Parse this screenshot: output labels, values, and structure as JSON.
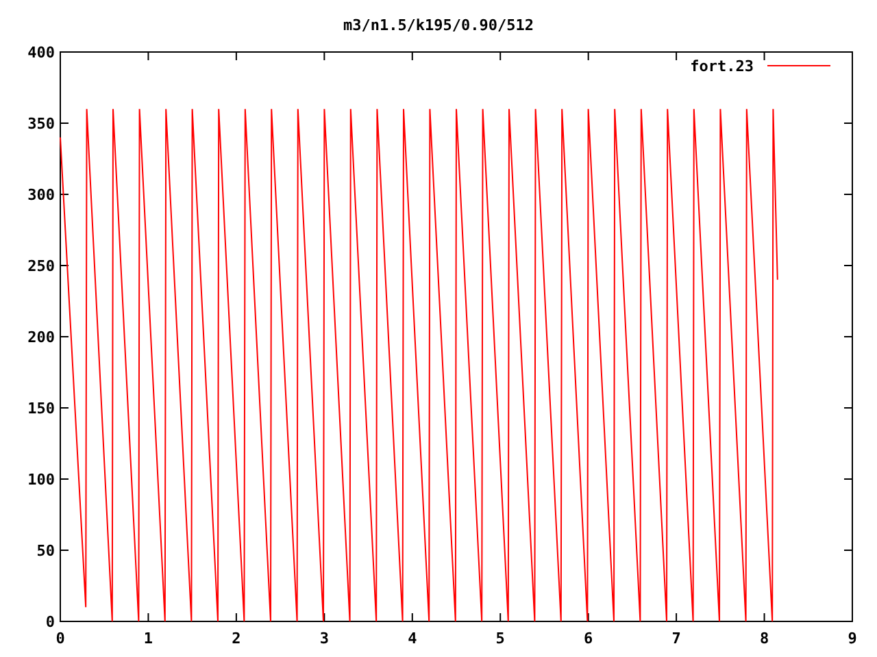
{
  "chart_data": {
    "type": "line",
    "title": "m3/n1.5/k195/0.90/512",
    "xlim": [
      0,
      9
    ],
    "ylim": [
      0,
      400
    ],
    "xticks": [
      0,
      1,
      2,
      3,
      4,
      5,
      6,
      7,
      8,
      9
    ],
    "yticks": [
      0,
      50,
      100,
      150,
      200,
      250,
      300,
      350,
      400
    ],
    "x": [
      0,
      0.29,
      0.3,
      0.59,
      0.6,
      0.89,
      0.9,
      1.19,
      1.2,
      1.49,
      1.5,
      1.79,
      1.8,
      2.09,
      2.1,
      2.39,
      2.4,
      2.69,
      2.7,
      2.99,
      3.0,
      3.29,
      3.3,
      3.59,
      3.6,
      3.89,
      3.9,
      4.19,
      4.2,
      4.49,
      4.5,
      4.79,
      4.8,
      5.09,
      5.1,
      5.39,
      5.4,
      5.69,
      5.7,
      5.99,
      6.0,
      6.29,
      6.3,
      6.59,
      6.6,
      6.89,
      6.9,
      7.19,
      7.2,
      7.49,
      7.5,
      7.79,
      7.8,
      8.09,
      8.1,
      8.15
    ],
    "series": [
      {
        "name": "fort.23",
        "color": "#ff0000",
        "values": [
          340,
          10,
          360,
          0,
          360,
          0,
          360,
          0,
          360,
          0,
          360,
          0,
          360,
          0,
          360,
          0,
          360,
          0,
          360,
          0,
          360,
          0,
          360,
          0,
          360,
          0,
          360,
          0,
          360,
          0,
          360,
          0,
          360,
          0,
          360,
          0,
          360,
          0,
          360,
          0,
          360,
          0,
          360,
          0,
          360,
          0,
          360,
          0,
          360,
          0,
          360,
          0,
          360,
          0,
          360,
          240
        ]
      }
    ]
  }
}
